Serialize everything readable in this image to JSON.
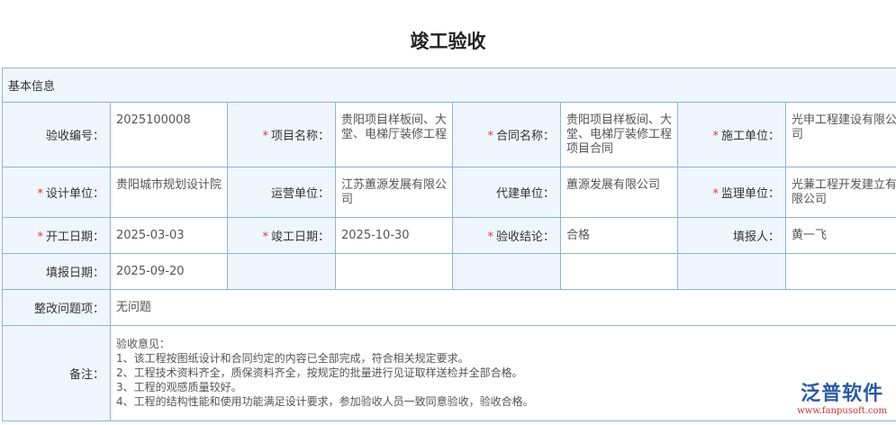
{
  "title": "竣工验收",
  "section": "基本信息",
  "rows": [
    [
      {
        "label": "验收编号：",
        "req": false,
        "value": "2025100008"
      },
      {
        "label": "项目名称：",
        "req": true,
        "value": "贵阳项目样板间、大堂、电梯厅装修工程"
      },
      {
        "label": "合同名称：",
        "req": true,
        "value": "贵阳项目样板间、大堂、电梯厅装修工程项目合同"
      },
      {
        "label": "施工单位：",
        "req": true,
        "value": "光申工程建设有限公司"
      }
    ],
    [
      {
        "label": "设计单位：",
        "req": true,
        "value": "贵阳城市规划设计院"
      },
      {
        "label": "运营单位：",
        "req": false,
        "value": "江苏蕙源发展有限公司"
      },
      {
        "label": "代建单位：",
        "req": false,
        "value": "蕙源发展有限公司"
      },
      {
        "label": "监理单位：",
        "req": true,
        "value": "光蒹工程开发建立有限公司"
      }
    ],
    [
      {
        "label": "开工日期：",
        "req": true,
        "value": "2025-03-03"
      },
      {
        "label": "竣工日期：",
        "req": true,
        "value": "2025-10-30"
      },
      {
        "label": "验收结论：",
        "req": true,
        "value": "合格"
      },
      {
        "label": "填报人：",
        "req": false,
        "value": "黄一飞"
      }
    ],
    [
      {
        "label": "填报日期：",
        "req": false,
        "value": "2025-09-20"
      }
    ]
  ],
  "rectify": {
    "label": "整改问题项：",
    "value": "无问题"
  },
  "remarks": {
    "label": "备注：",
    "lines": [
      "验收意见：",
      "1、该工程按图纸设计和合同约定的内容已全部完成，符合相关规定要求。",
      "2、工程技术资料齐全，质保资料齐全，按规定的批量进行见证取样送检并全部合格。",
      "3、工程的观感质量较好。",
      "4、工程的结构性能和使用功能满足设计要求，参加验收人员一致同意验收，验收合格。"
    ]
  },
  "logo": {
    "name": "泛普软件",
    "url": "www.fanpusoft.com"
  }
}
